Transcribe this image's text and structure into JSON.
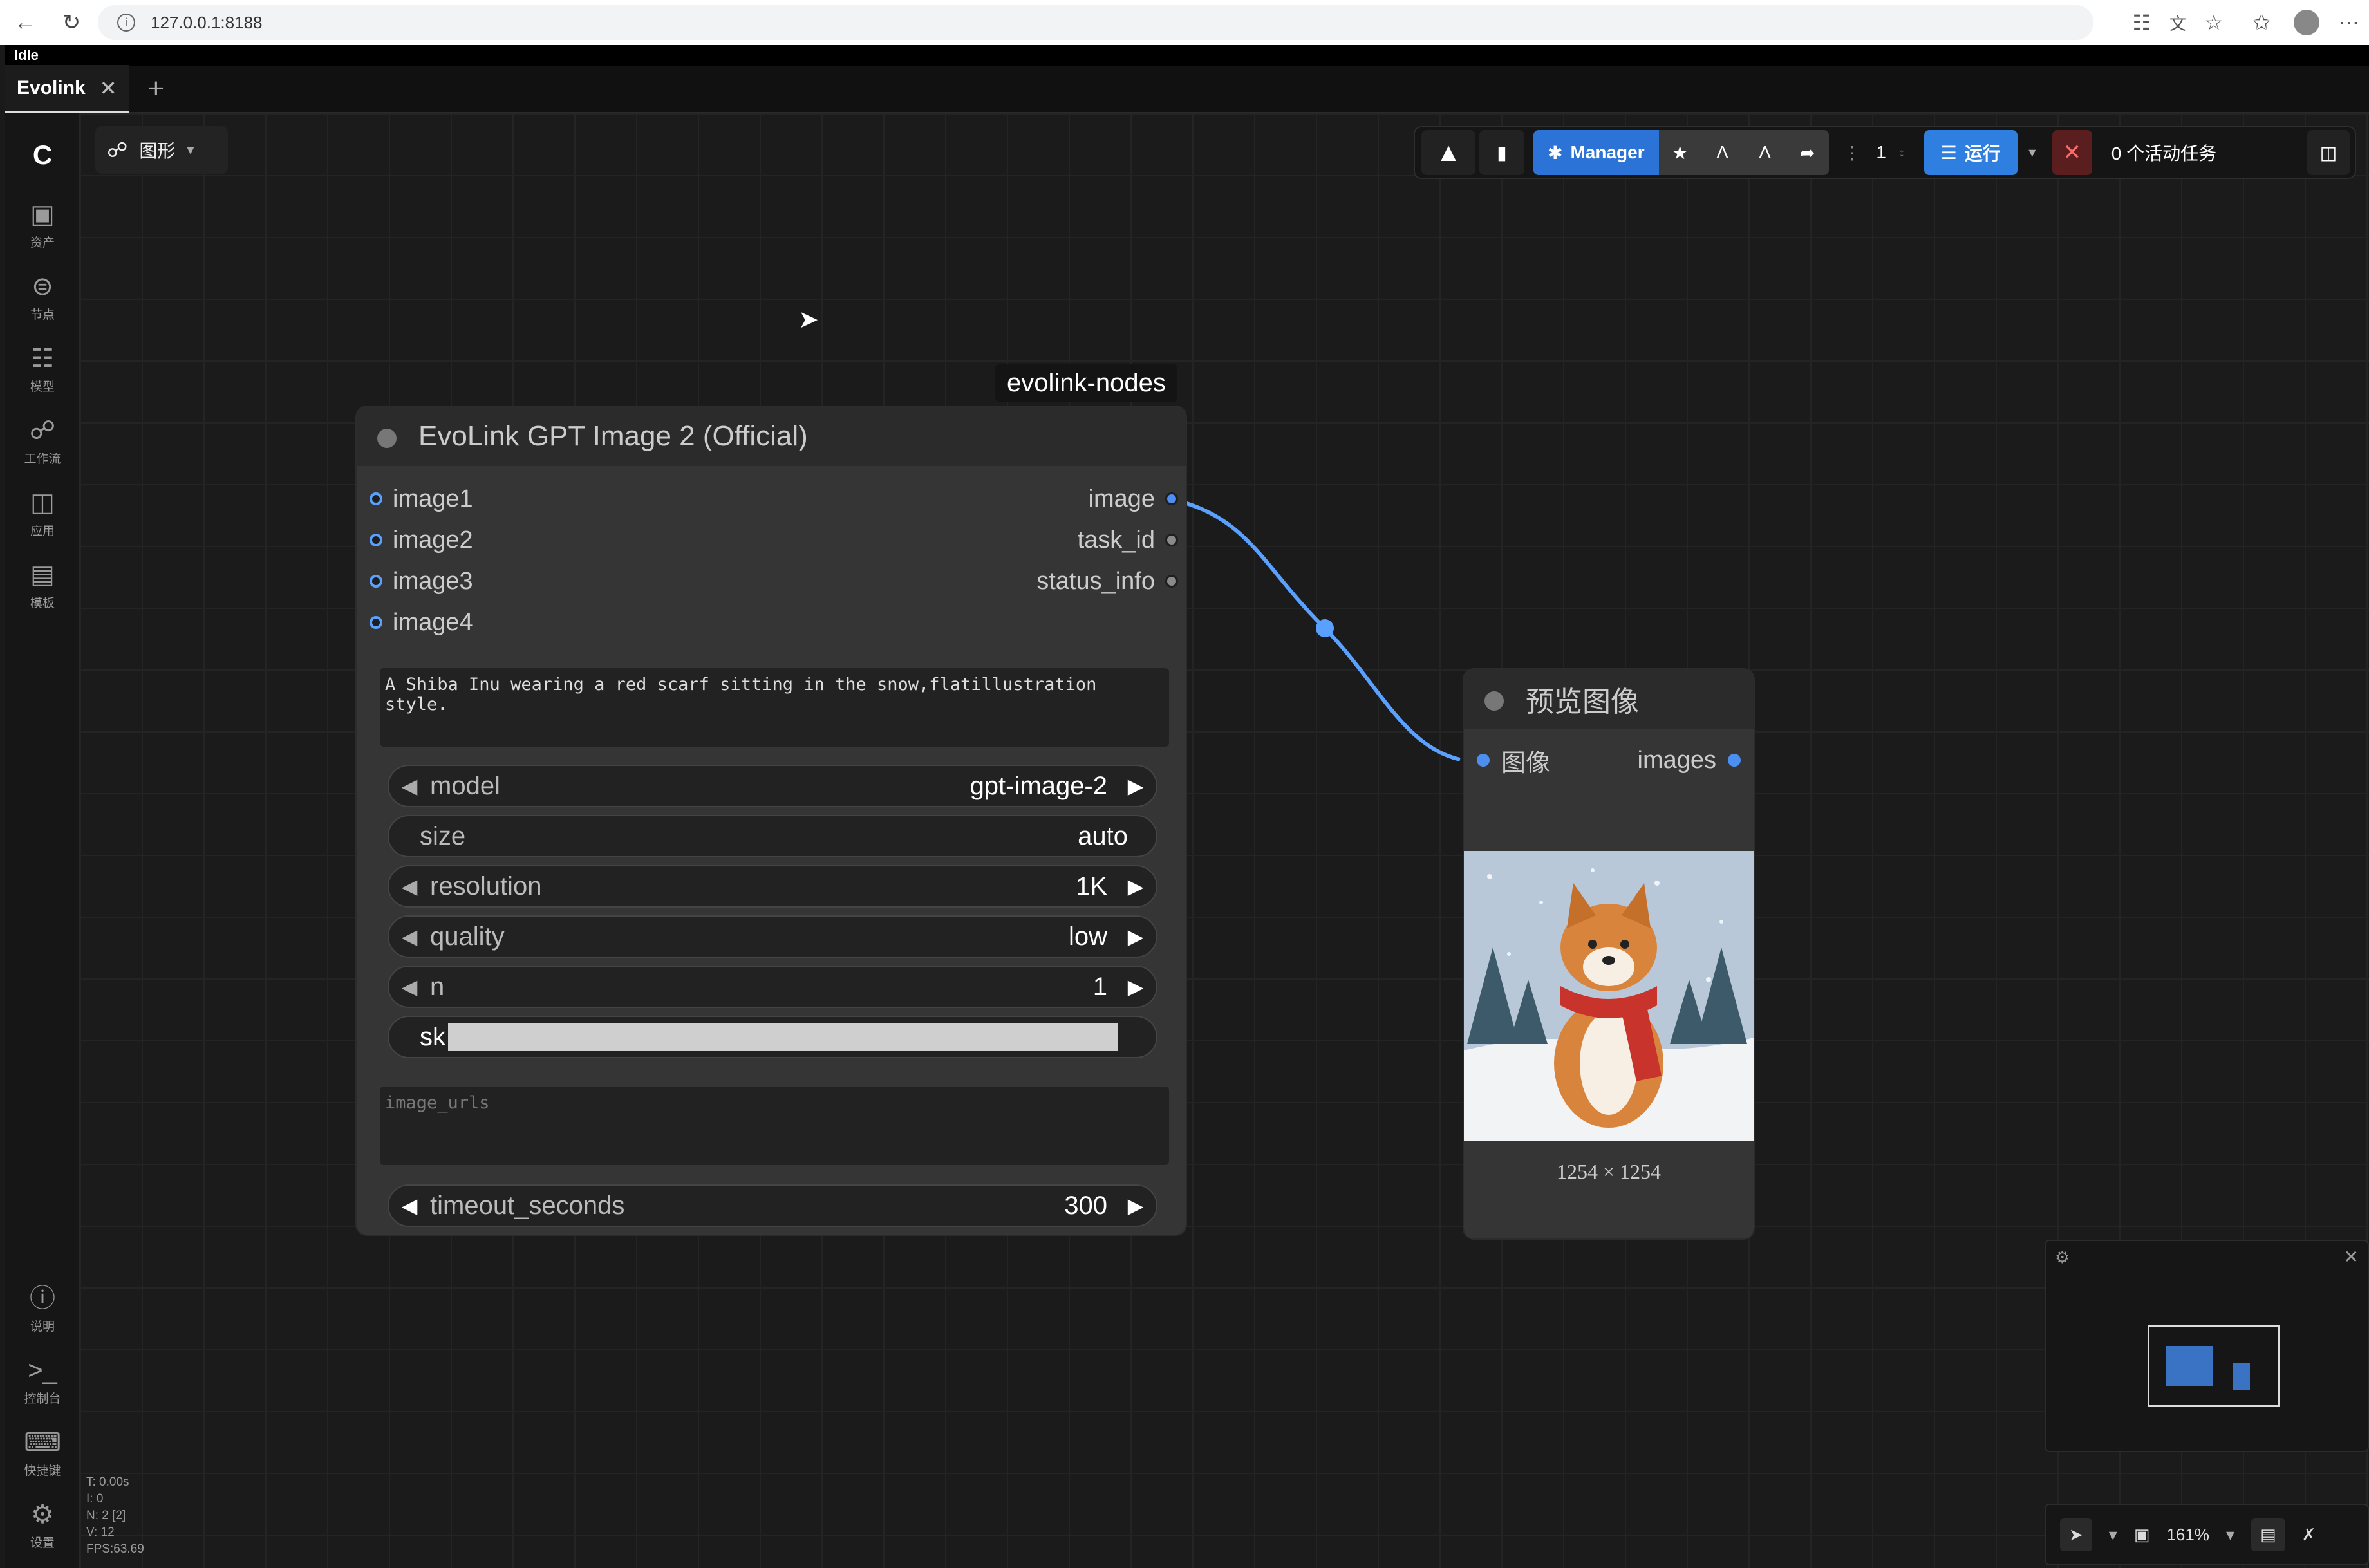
{
  "browser": {
    "url": "127.0.0.1:8188"
  },
  "app": {
    "status": "Idle",
    "tab_label": "Evolink"
  },
  "sidebar": {
    "items": [
      {
        "icon": "image-icon",
        "label": "资产"
      },
      {
        "icon": "node-icon",
        "label": "节点"
      },
      {
        "icon": "model-icon",
        "label": "模型"
      },
      {
        "icon": "workflow-icon",
        "label": "工作流"
      },
      {
        "icon": "app-icon",
        "label": "应用"
      },
      {
        "icon": "template-icon",
        "label": "模板"
      }
    ],
    "bottom_items": [
      {
        "icon": "help-icon",
        "label": "说明"
      },
      {
        "icon": "console-icon",
        "label": "控制台"
      },
      {
        "icon": "keyboard-icon",
        "label": "快捷键"
      },
      {
        "icon": "settings-icon",
        "label": "设置"
      }
    ]
  },
  "graph_mode": {
    "label": "图形"
  },
  "toolbar": {
    "manager_label": "Manager",
    "batch_count": "1",
    "run_label": "运行",
    "active_tasks_label": "0 个活动任务"
  },
  "group_label": "evolink-nodes",
  "gpt_node": {
    "title": "EvoLink GPT Image 2 (Official)",
    "inputs": [
      "image1",
      "image2",
      "image3",
      "image4"
    ],
    "outputs": [
      "image",
      "task_id",
      "status_info"
    ],
    "prompt": "A Shiba Inu wearing a red scarf sitting in the snow,flatillustration style.",
    "widgets": [
      {
        "name": "model",
        "value": "gpt-image-2",
        "arrows": true
      },
      {
        "name": "size",
        "value": "auto",
        "arrows": false
      },
      {
        "name": "resolution",
        "value": "1K",
        "arrows": true
      },
      {
        "name": "quality",
        "value": "low",
        "arrows": true
      },
      {
        "name": "n",
        "value": "1",
        "arrows": true
      }
    ],
    "sk_label": "sk",
    "image_urls_placeholder": "image_urls",
    "timeout": {
      "name": "timeout_seconds",
      "value": "300"
    }
  },
  "preview_node": {
    "title": "预览图像",
    "input_label": "图像",
    "output_label": "images",
    "image_size": "1254 × 1254"
  },
  "zoom": {
    "level": "161%"
  },
  "stats": [
    "T: 0.00s",
    "I: 0",
    "N: 2 [2]",
    "V: 12",
    "FPS:63.69"
  ],
  "colors": {
    "link": "#5aa0ff",
    "run": "#2e7fe0",
    "manager": "#2b73d6"
  }
}
